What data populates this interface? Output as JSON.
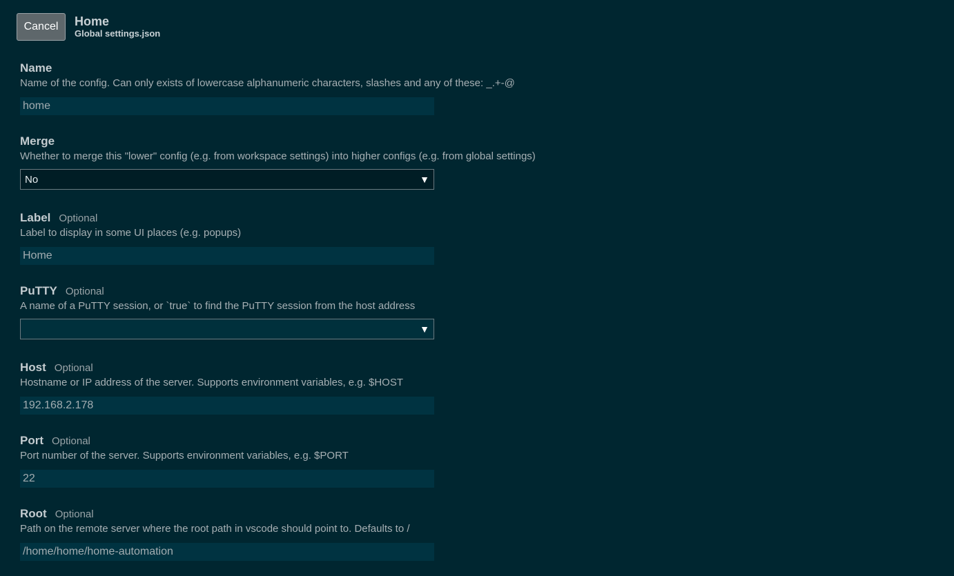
{
  "header": {
    "cancel_label": "Cancel",
    "title": "Home",
    "subtitle": "Global settings.json"
  },
  "optional_tag": "Optional",
  "fields": {
    "name": {
      "label": "Name",
      "description": "Name of the config. Can only exists of lowercase alphanumeric characters, slashes and any of these: _.+-@",
      "value": "home"
    },
    "merge": {
      "label": "Merge",
      "description": "Whether to merge this \"lower\" config (e.g. from workspace settings) into higher configs (e.g. from global settings)",
      "value": "No"
    },
    "label": {
      "label": "Label",
      "description": "Label to display in some UI places (e.g. popups)",
      "value": "Home"
    },
    "putty": {
      "label": "PuTTY",
      "description": "A name of a PuTTY session, or `true` to find the PuTTY session from the host address",
      "value": ""
    },
    "host": {
      "label": "Host",
      "description": "Hostname or IP address of the server. Supports environment variables, e.g. $HOST",
      "value": "192.168.2.178"
    },
    "port": {
      "label": "Port",
      "description": "Port number of the server. Supports environment variables, e.g. $PORT",
      "value": "22"
    },
    "root": {
      "label": "Root",
      "description": "Path on the remote server where the root path in vscode should point to. Defaults to /",
      "value": "/home/home/home-automation"
    }
  },
  "icons": {
    "dropdown": "chevron-down-icon"
  },
  "colors": {
    "background": "#002630",
    "input_background": "#003341",
    "select_background": "#001d25",
    "button_background": "#5e676b"
  }
}
